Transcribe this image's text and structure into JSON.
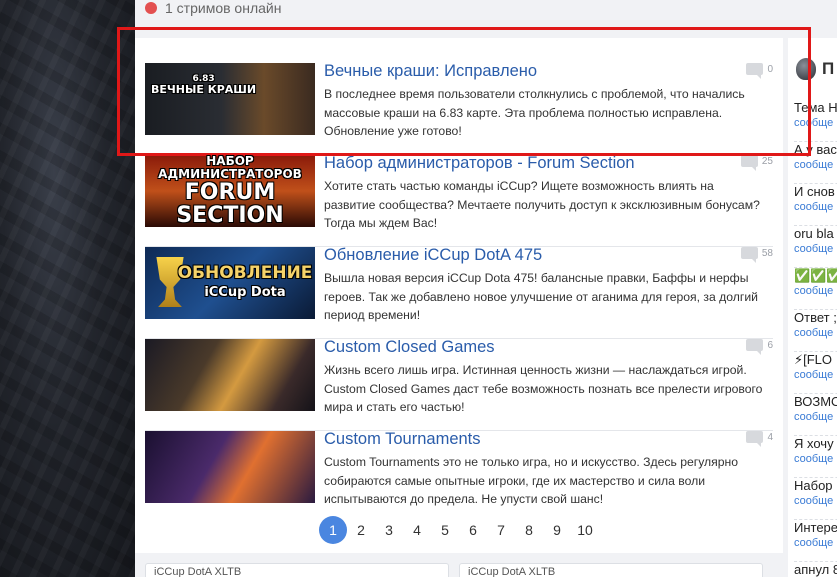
{
  "streams": {
    "label": "1 стримов онлайн"
  },
  "news": [
    {
      "thumb_line1": "6.83",
      "thumb_line2": "ВЕЧНЫЕ КРАШИ",
      "title": "Вечные краши: Исправлено",
      "description": "В последнее время пользователи столкнулись с проблемой, что начались массовые краши на 6.83 карте. Эта проблема полностью исправлена. Обновление уже готово!",
      "comments": "0"
    },
    {
      "thumb_line1": "НАБОР АДМИНИСТРАТОРОВ",
      "thumb_line2": "FORUM SECTION",
      "title": "Набор администраторов - Forum Section",
      "description": "Хотите стать частью команды iCCup? Ищете возможность влиять на развитие сообщества? Мечтаете получить доступ к эксклюзивным бонусам? Тогда мы ждем Вас!",
      "comments": "25"
    },
    {
      "thumb_line1": "ОБНОВЛЕНИЕ",
      "thumb_line2": "iCCup Dota",
      "title": "Обновление iCCup DotA 475",
      "description": "Вышла новая версия iCCup Dota 475! балансные правки, Баффы и нерфы героев. Так же добавлено новое улучшение от аганима для героя, за долгий период времени!",
      "comments": "58"
    },
    {
      "title": "Custom Closed Games",
      "description": "Жизнь всего лишь игра. Истинная ценность жизни — наслаждаться игрой. Custom Closed Games даст тебе возможность познать все прелести игрового мира и стать его частью!",
      "comments": "6"
    },
    {
      "title": "Custom Tournaments",
      "description": "Custom Tournaments это не только игра, но и искусство. Здесь регулярно собираются самые опытные игроки, где их мастерство и сила воли испытываются до предела. Не упусти свой шанс!",
      "comments": "4"
    }
  ],
  "pagination": {
    "pages": [
      "1",
      "2",
      "3",
      "4",
      "5",
      "6",
      "7",
      "8",
      "9",
      "10"
    ],
    "active": "1"
  },
  "bottom_cards": [
    "iCCup DotA XLTB",
    "iCCup DotA XLTB"
  ],
  "sidebar": {
    "header": "П",
    "items": [
      {
        "title": "Тема Н",
        "sub": "сообще"
      },
      {
        "title": "А у вас",
        "sub": "сообще"
      },
      {
        "title": "И снов",
        "sub": "сообще"
      },
      {
        "title": "oru bla",
        "sub": "сообще"
      },
      {
        "title": "✅✅✅",
        "sub": "сообще"
      },
      {
        "title": "Ответ ;",
        "sub": "сообще"
      },
      {
        "title": "⚡[FLO",
        "sub": "сообще"
      },
      {
        "title": "ВОЗМО",
        "sub": "сообще"
      },
      {
        "title": "Я хочу",
        "sub": "сообще"
      },
      {
        "title": "Набор",
        "sub": "сообще"
      },
      {
        "title": "Интере",
        "sub": "сообще"
      },
      {
        "title": "апнул 8",
        "sub": ""
      }
    ]
  },
  "colors": {
    "accent": "#2a5caa",
    "highlight_box": "#e01818",
    "active_page": "#4a86e0"
  }
}
